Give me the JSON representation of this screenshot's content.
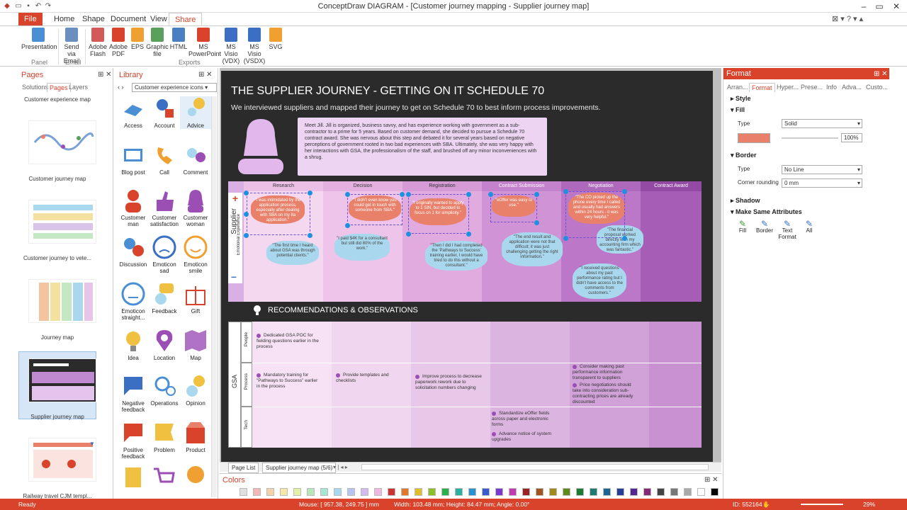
{
  "app": {
    "window_title": "ConceptDraw DIAGRAM - [Customer journey mapping - Supplier journey map]"
  },
  "menu": {
    "file": "File",
    "home": "Home",
    "shape": "Shape",
    "document": "Document",
    "view": "View",
    "share": "Share"
  },
  "ribbon": {
    "presentation": "Presentation",
    "send_email": "Send via Email",
    "adobe_flash": "Adobe Flash",
    "adobe_pdf": "Adobe PDF",
    "eps": "EPS",
    "graphic_file": "Graphic file",
    "html": "HTML",
    "ms_powerpoint": "MS PowerPoint",
    "ms_visio_vdx": "MS Visio (VDX)",
    "ms_visio_vsdx": "MS Visio (VSDX)",
    "svg": "SVG",
    "group_panel": "Panel",
    "group_email": "Email",
    "group_exports": "Exports"
  },
  "pages_panel": {
    "title": "Pages",
    "tabs": [
      "Solutions",
      "Pages",
      "Layers"
    ],
    "top_label": "Customer experience map",
    "pages": [
      "Customer journey map",
      "Customer journey to vete...",
      "Journey map",
      "Supplier journey map",
      "Railway travel CJM templ..."
    ]
  },
  "library_panel": {
    "title": "Library",
    "dropdown": "Customer experience icons",
    "items": [
      "Access",
      "Account",
      "Advice",
      "Blog post",
      "Call",
      "Comment",
      "Customer man",
      "Customer satisfaction",
      "Customer woman",
      "Discussion",
      "Emoticon sad",
      "Emoticon smile",
      "Emoticon straight...",
      "Feedback",
      "Gift",
      "Idea",
      "Location",
      "Map",
      "Negative feedback",
      "Operations",
      "Opinion",
      "Positive feedback",
      "Problem",
      "Product"
    ]
  },
  "diagram": {
    "title": "THE SUPPLIER JOURNEY - GETTING ON IT SCHEDULE 70",
    "subtitle": "We interviewed suppliers and mapped their journey to get on Schedule 70 to best inform process improvements.",
    "persona_text": "Meet Jill. Jill is organized, business savvy, and has experience working with government as a sub-contractor to a prime for 5 years. Based on customer demand, she decided to pursue a Schedule 70 contract award. She was nervous about this step and debated it for several years based on negative perceptions of government rooted in two bad experiences with SBA. Ultimately, she was very happy with her interactions with GSA, the professionalism of the staff, and brushed off any minor inconveniences with a shrug.",
    "stages": [
      "Research",
      "Decision",
      "Registration",
      "Contract Submission",
      "Negotiation",
      "Contract Award"
    ],
    "row_label_supplier": "Supplier",
    "row_label_emotional": "Emotional Experience",
    "quotes_orange": [
      "\"I was intimidated by the application process, especially after dealing with SBA on my 8a application.\"",
      "\"I didn't even know you could get in touch with someone from SBA.\"",
      "\"I originally wanted to apply to 1 SIN, but decided to focus on 1 for simplicity.\"",
      "\"eOffer was easy to use.\"",
      "\"The CO picked up the phone every time I called and usually had answers within 24 hours - it was very helpful.\""
    ],
    "quotes_blue": [
      "\"The first time I heard about GSA was through potential clients.\"",
      "\"I paid $4K for a consultant but still did 80% of the work.\"",
      "\"Then I did I had completed the 'Pathways to Success' training earlier, I would have tried to do this without a consultant.\"",
      "\"The end result and application were not that difficult; it was just challenging getting the right information.\"",
      "\"The financial proposal worked directly with my accounting firm which was fantastic.\"",
      "\"I received questions about my past performance rating but I didn't have access to the comments from customers.\""
    ],
    "recommendations_title": "RECOMMENDATIONS & OBSERVATIONS",
    "gsa_label": "GSA",
    "row_people": "People",
    "row_process": "Process",
    "row_tech": "Tech",
    "rec_people_1": "Dedicated GSA POC for fielding questions earlier in the process",
    "rec_process_1": "Mandatory training for \"Pathways to Success\" earlier in the process",
    "rec_process_2": "Provide templates and checklists",
    "rec_process_3": "Improve process to decrease paperwork rework due to solicitation numbers changing",
    "rec_process_4": "Consider making past performance information transparent to suppliers",
    "rec_process_5": "Price negotiations should take into consideration sub-contracting prices are already discounted",
    "rec_tech_1": "Standardize eOffer fields across paper and electronic forms",
    "rec_tech_2": "Advance notice of system upgrades"
  },
  "canvas_bottom": {
    "page_list": "Page List",
    "current_page": "Supplier journey map (5/6)"
  },
  "format_panel": {
    "title": "Format",
    "tabs": [
      "Arran...",
      "Format",
      "Hyper...",
      "Prese...",
      "Info",
      "Adva...",
      "Custo..."
    ],
    "style": "Style",
    "fill": "Fill",
    "type_label": "Type",
    "fill_type": "Solid",
    "percent": "100%",
    "border": "Border",
    "border_type": "No Line",
    "corner_label": "Corner rounding",
    "corner_value": "0 mm",
    "shadow": "Shadow",
    "make_same": "Make Same Attributes",
    "btn_fill": "Fill",
    "btn_border": "Border",
    "btn_text": "Text Format",
    "btn_all": "All",
    "fill_color": "#e8806a"
  },
  "colors_panel": {
    "title": "Colors"
  },
  "status": {
    "ready": "Ready",
    "mouse": "Mouse: [ 957.38, 249.75 ] mm",
    "size": "Width: 103.48 mm;  Height: 84.47 mm;  Angle: 0.00°",
    "id": "ID: 552164",
    "zoom": "29%"
  }
}
